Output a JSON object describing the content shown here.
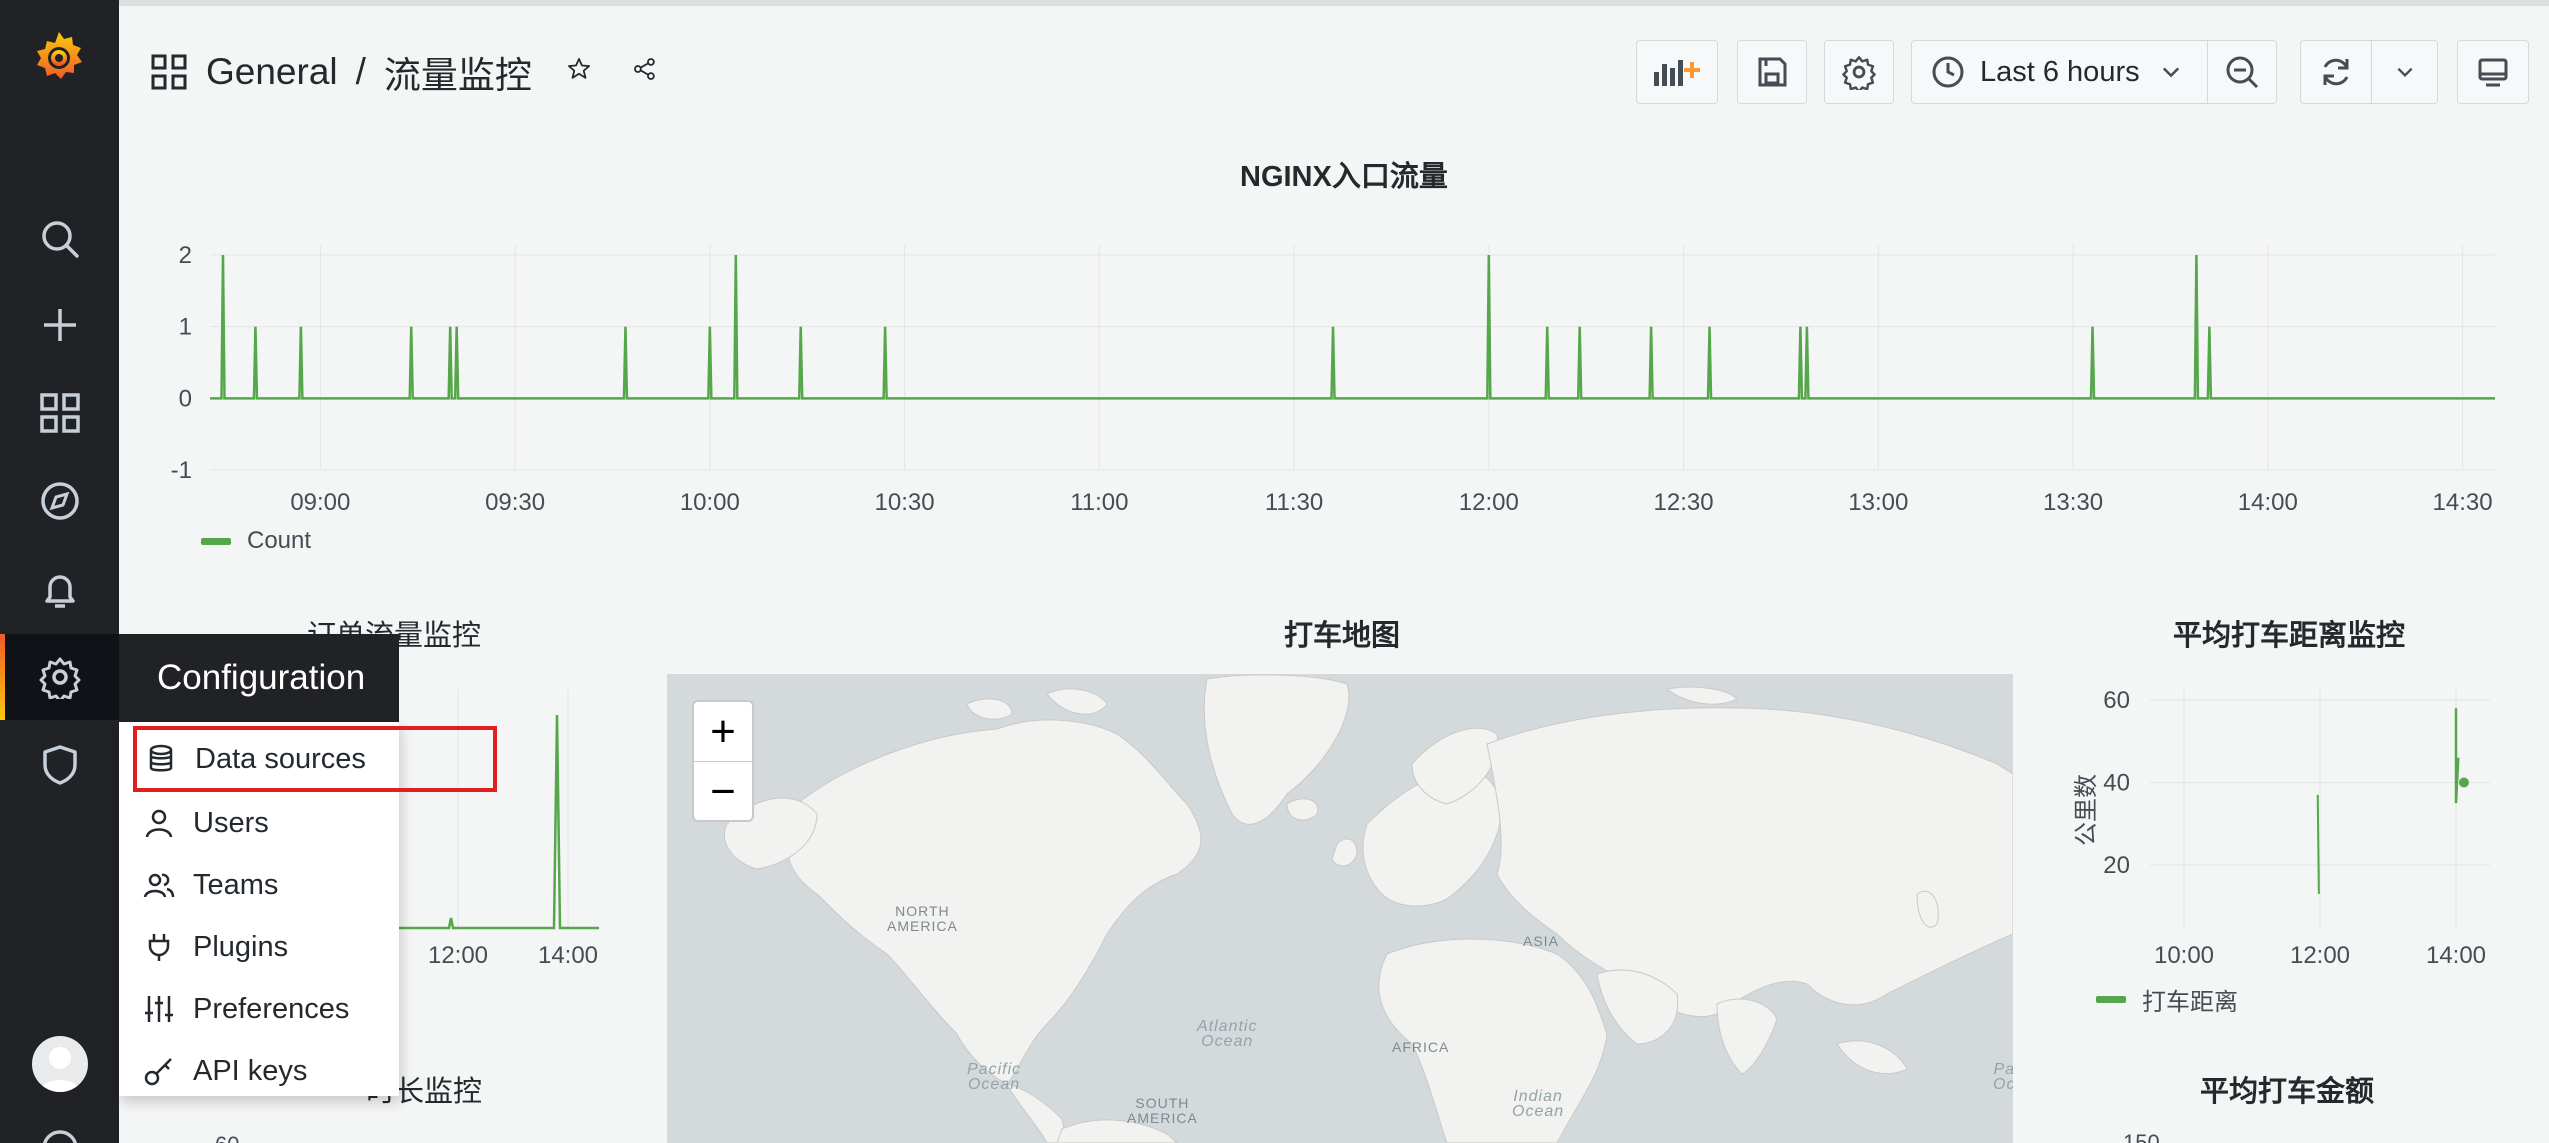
{
  "breadcrumb": {
    "folder": "General",
    "separator": "/",
    "dashboard": "流量监控"
  },
  "toolbar": {
    "time_range": "Last 6 hours"
  },
  "config_menu": {
    "title": "Configuration",
    "items": [
      "Data sources",
      "Users",
      "Teams",
      "Plugins",
      "Preferences",
      "API keys"
    ]
  },
  "panels": {
    "nginx": {
      "title": "NGINX入口流量",
      "y_ticks": [
        "2",
        "1",
        "0",
        "-1"
      ],
      "x_ticks": [
        "09:00",
        "09:30",
        "10:00",
        "10:30",
        "11:00",
        "11:30",
        "12:00",
        "12:30",
        "13:00",
        "13:30",
        "14:00",
        "14:30"
      ],
      "legend": "Count"
    },
    "orders": {
      "title": "订单流量监控",
      "x_ticks": [
        "12:00",
        "14:00"
      ]
    },
    "map": {
      "title": "打车地图",
      "zoom_in": "+",
      "zoom_out": "−",
      "labels": {
        "north_america": "NORTH\nAMERICA",
        "asia": "ASIA",
        "africa": "AFRICA",
        "south_america": "SOUTH\nAMERICA",
        "pacific1": "Pacific\nOcean",
        "atlantic": "Atlantic\nOcean",
        "indian": "Indian\nOcean",
        "pacific2": "Pa\nOc"
      }
    },
    "avg_distance": {
      "title": "平均打车距离监控",
      "ylabel": "公里数",
      "y_ticks": [
        "60",
        "40",
        "20"
      ],
      "x_ticks": [
        "10:00",
        "12:00",
        "14:00"
      ],
      "legend": "打车距离"
    },
    "duration": {
      "title_partial": "时长监控",
      "y_tick_partial": "60"
    },
    "avg_amount": {
      "title": "平均打车金额",
      "y_tick_partial": "150"
    }
  },
  "chart_data": [
    {
      "type": "line",
      "title": "NGINX入口流量",
      "x_unit": "time (HH:MM)",
      "ylim": [
        -1,
        2
      ],
      "series": [
        {
          "name": "Count",
          "points": [
            [
              "08:45",
              2
            ],
            [
              "08:50",
              1
            ],
            [
              "08:57",
              1
            ],
            [
              "09:14",
              1
            ],
            [
              "09:20",
              1
            ],
            [
              "09:21",
              1
            ],
            [
              "09:47",
              1
            ],
            [
              "10:00",
              1
            ],
            [
              "10:04",
              2
            ],
            [
              "10:14",
              1
            ],
            [
              "10:27",
              1
            ],
            [
              "11:36",
              1
            ],
            [
              "12:00",
              2
            ],
            [
              "12:09",
              1
            ],
            [
              "12:14",
              1
            ],
            [
              "12:25",
              1
            ],
            [
              "12:34",
              1
            ],
            [
              "12:48",
              1
            ],
            [
              "12:49",
              1
            ],
            [
              "13:33",
              1
            ],
            [
              "13:49",
              2
            ],
            [
              "13:51",
              1
            ]
          ]
        }
      ],
      "color": "#56a64b"
    },
    {
      "type": "line",
      "title": "平均打车距离监控",
      "ylabel": "公里数",
      "series": [
        {
          "name": "打车距离",
          "points": [
            [
              "11:58",
              37
            ],
            [
              "11:59",
              13
            ],
            [
              "14:00",
              58
            ],
            [
              "14:00",
              35
            ],
            [
              "14:02",
              46
            ],
            [
              "14:07",
              40
            ]
          ]
        }
      ],
      "color": "#56a64b"
    }
  ]
}
